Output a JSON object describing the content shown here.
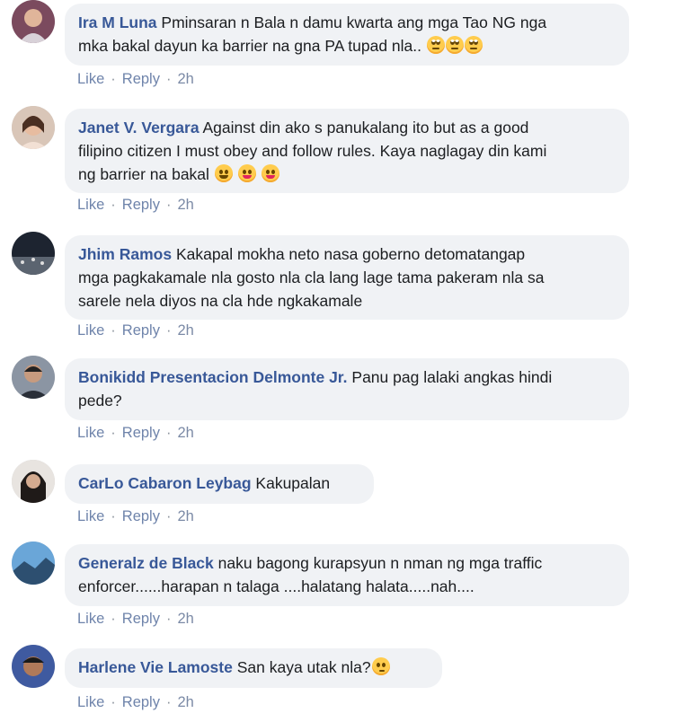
{
  "comments": [
    {
      "author": "Ira M Luna",
      "text": "Pminsaran n Bala n damu kwarta ang mga Tao NG nga\nmka bakal dayun ka barrier na gna PA tupad nla.. ",
      "emojis": [
        "eye-roll-emoji",
        "eye-roll-emoji",
        "eye-roll-emoji"
      ],
      "avatar_color": "#7b4a5e",
      "like": "Like",
      "reply": "Reply",
      "time": "2h"
    },
    {
      "author": "Janet V. Vergara",
      "text": "Against din ako s panukalang ito but as a good\nfilipino citizen I must obey and follow rules. Kaya naglagay din kami\nng barrier na bakal ",
      "emojis": [
        "grinning-emoji",
        "winking-tongue-emoji",
        "winking-tongue-emoji"
      ],
      "avatar_color": "#c9a38a",
      "like": "Like",
      "reply": "Reply",
      "time": "2h"
    },
    {
      "author": "Jhim Ramos",
      "text": "Kakapal mokha neto nasa goberno detomatangap\nmga pagkakamale nla gosto nla cla lang lage tama pakeram nla sa\nsarele nela diyos na cla hde ngkakamale",
      "emojis": [],
      "avatar_color": "#2b3440",
      "like": "Like",
      "reply": "Reply",
      "time": "2h"
    },
    {
      "author": "Bonikidd Presentacion Delmonte Jr.",
      "text": "Panu pag lalaki angkas hindi\npede?",
      "emojis": [],
      "avatar_color": "#4a5260",
      "like": "Like",
      "reply": "Reply",
      "time": "2h"
    },
    {
      "author": "CarLo Cabaron Leybag",
      "text": "Kakupalan",
      "emojis": [],
      "avatar_color": "#3a3230",
      "like": "Like",
      "reply": "Reply",
      "time": "2h"
    },
    {
      "author": "Generalz de Black",
      "text": "naku bagong kurapsyun n nman ng mga traffic\nenforcer......harapan n talaga ....halatang halata.....nah....",
      "emojis": [],
      "avatar_color": "#4f86b8",
      "like": "Like",
      "reply": "Reply",
      "time": "2h"
    },
    {
      "author": "Harlene Vie Lamoste",
      "text": "San kaya utak nla?",
      "emojis": [
        "thinking-emoji"
      ],
      "avatar_color": "#3f5aa0",
      "like": "Like",
      "reply": "Reply",
      "time": "2h"
    }
  ]
}
